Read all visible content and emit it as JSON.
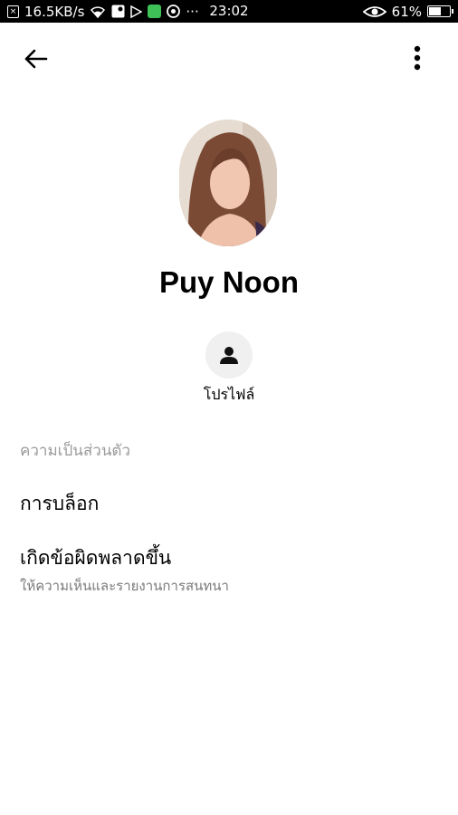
{
  "status_bar": {
    "speed": "16.5KB/s",
    "time": "23:02",
    "battery_percent": "61%",
    "battery_level": 0.61,
    "dots": "···"
  },
  "contact": {
    "name": "Puy Noon"
  },
  "actions": {
    "profile_label": "โปรไฟล์"
  },
  "privacy": {
    "section_title": "ความเป็นส่วนตัว",
    "items": [
      {
        "title": "การบล็อก"
      },
      {
        "title": "เกิดข้อผิดพลาดขึ้น",
        "subtitle": "ให้ความเห็นและรายงานการสนทนา"
      }
    ]
  }
}
